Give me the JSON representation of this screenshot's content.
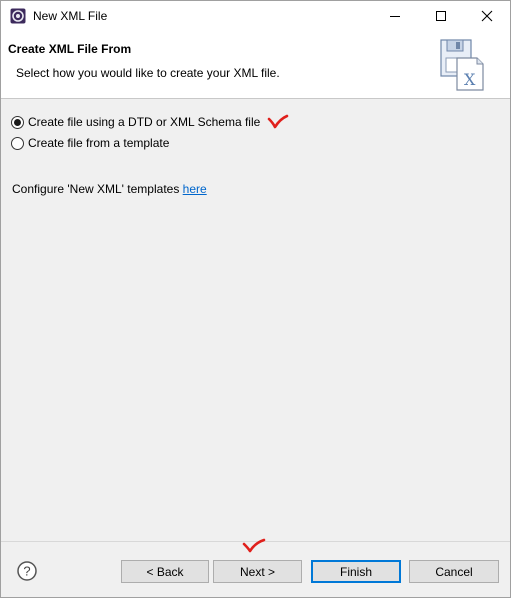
{
  "window": {
    "title": "New XML File"
  },
  "header": {
    "title": "Create XML File From",
    "description": "Select how you would like to create your XML file."
  },
  "options": {
    "dtd_schema": "Create file using a DTD or XML Schema file",
    "template": "Create file from a template",
    "selected": "dtd_schema"
  },
  "configure": {
    "prefix": "Configure 'New XML' templates ",
    "link": "here"
  },
  "buttons": {
    "help": "?",
    "back": "< Back",
    "next": "Next >",
    "finish": "Finish",
    "cancel": "Cancel"
  },
  "colors": {
    "annotation_check": "#e0201c",
    "link": "#0066cc",
    "default_button_border": "#0078d7"
  }
}
